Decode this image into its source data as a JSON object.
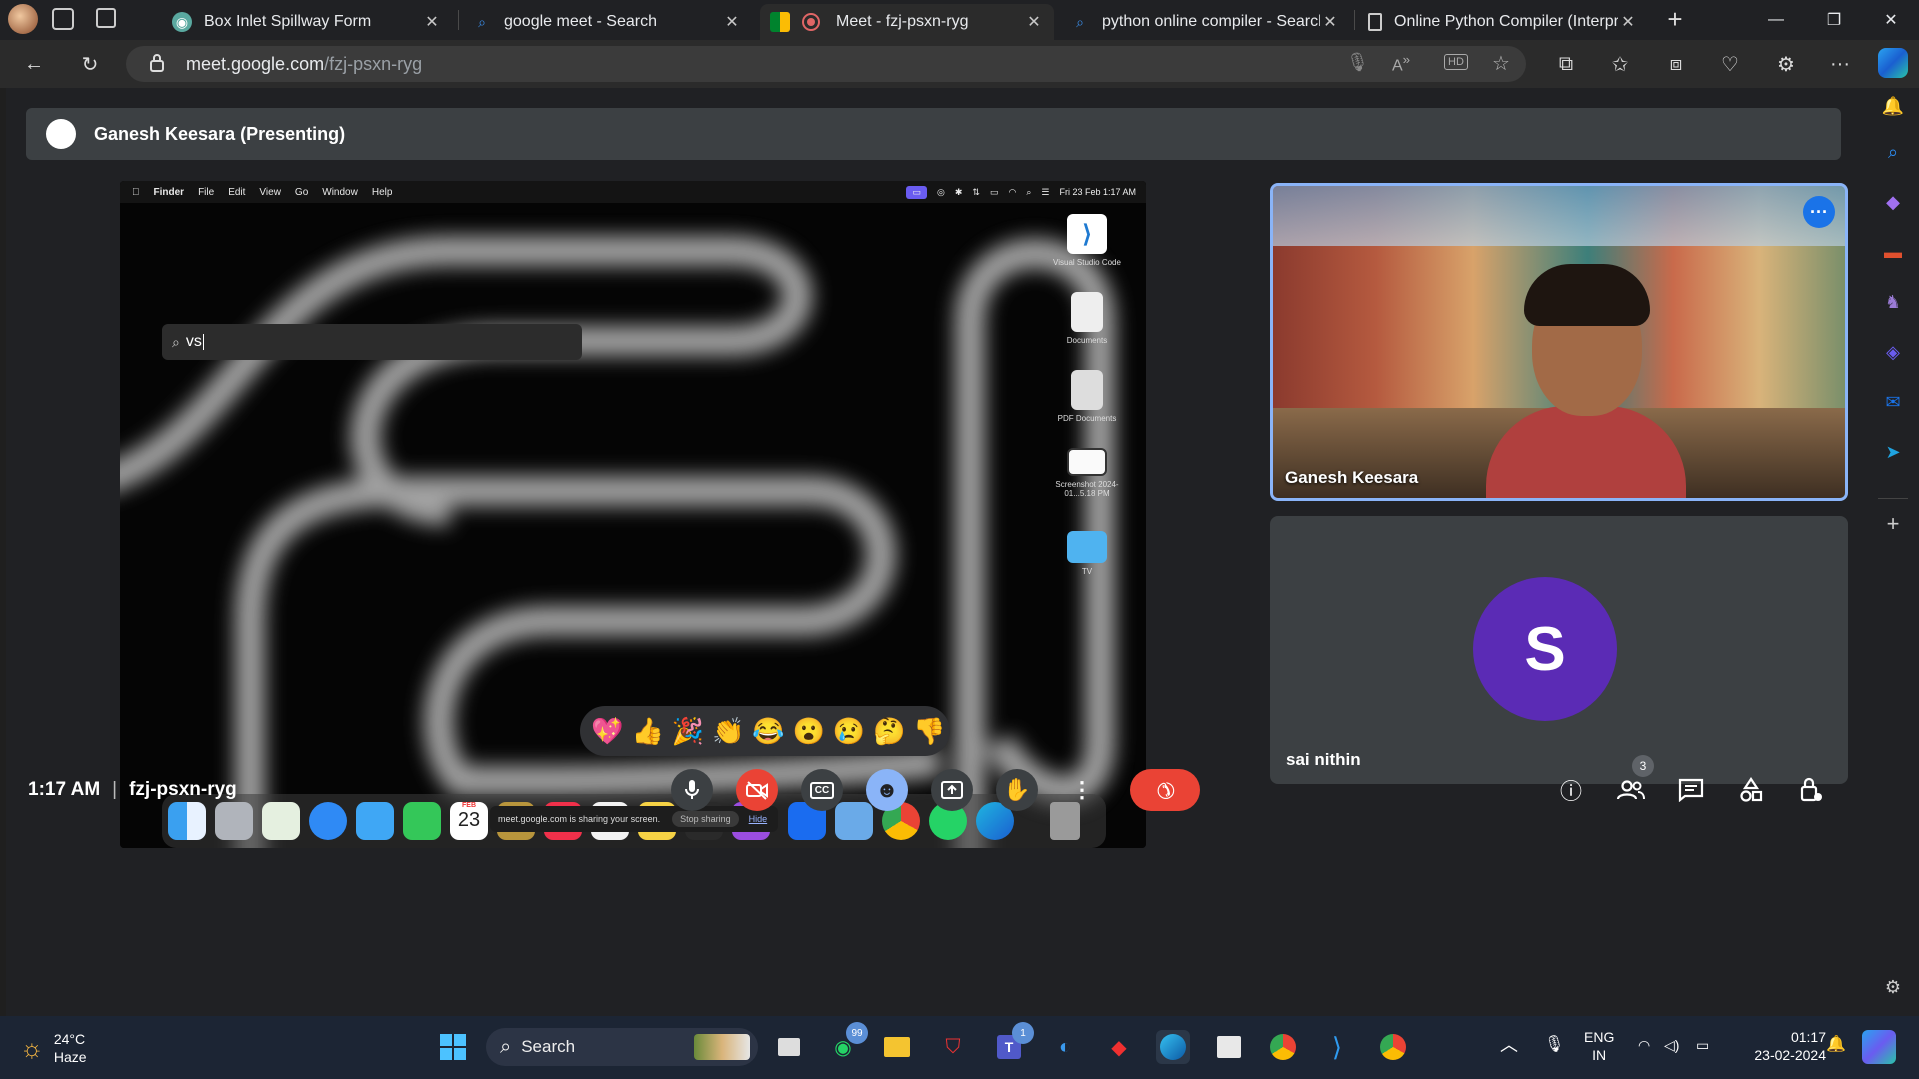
{
  "browser": {
    "tabs": [
      {
        "title": "Box Inlet Spillway Form",
        "favicon": "form-icon",
        "active": false
      },
      {
        "title": "google meet - Search",
        "favicon": "search-icon",
        "active": false
      },
      {
        "title": "Meet - fzj-psxn-ryg",
        "favicon": "meet-icon",
        "active": true
      },
      {
        "title": "python online compiler - Search",
        "favicon": "search-icon",
        "active": false
      },
      {
        "title": "Online Python Compiler (Interpre",
        "favicon": "page-icon",
        "active": false
      }
    ],
    "new_tab_label": "+",
    "url_host": "meet.google.com",
    "url_path": "/fzj-psxn-ryg"
  },
  "meet": {
    "presenting_label": "Ganesh Keesara (Presenting)",
    "meeting_time": "1:17 AM",
    "separator": "|",
    "meeting_code": "fzj-psxn-ryg",
    "participants": [
      {
        "name": "Ganesh Keesara",
        "has_video": true
      },
      {
        "name": "sai nithin",
        "initial": "S",
        "avatar_color": "#5b2bb5"
      }
    ],
    "participant_count": "3",
    "reactions": [
      "💖",
      "👍",
      "🎉",
      "👏",
      "😂",
      "😮",
      "😢",
      "🤔",
      "👎"
    ]
  },
  "shared_screen": {
    "menu": [
      "Finder",
      "File",
      "Edit",
      "View",
      "Go",
      "Window",
      "Help"
    ],
    "clock": "Fri 23 Feb  1:17 AM",
    "spotlight_query": "vs",
    "desktop_icons": [
      {
        "label": "Visual Studio Code"
      },
      {
        "label": "Documents"
      },
      {
        "label": "PDF Documents"
      },
      {
        "label": "Screenshot 2024-01...5.18 PM"
      },
      {
        "label": "TV"
      }
    ],
    "dock_calendar_month": "FEB",
    "dock_calendar_day": "23",
    "share_notice": "meet.google.com is sharing your screen.",
    "stop_sharing": "Stop sharing",
    "hide": "Hide"
  },
  "taskbar": {
    "weather_temp": "24°C",
    "weather_desc": "Haze",
    "search_label": "Search",
    "whatsapp_badge": "99",
    "teams_badge": "1",
    "lang_top": "ENG",
    "lang_bottom": "IN",
    "time": "01:17",
    "date": "23-02-2024"
  },
  "colors": {
    "accent_blue": "#8ab4f8",
    "meet_red": "#ea4335",
    "avatar_purple": "#5b2bb5"
  }
}
